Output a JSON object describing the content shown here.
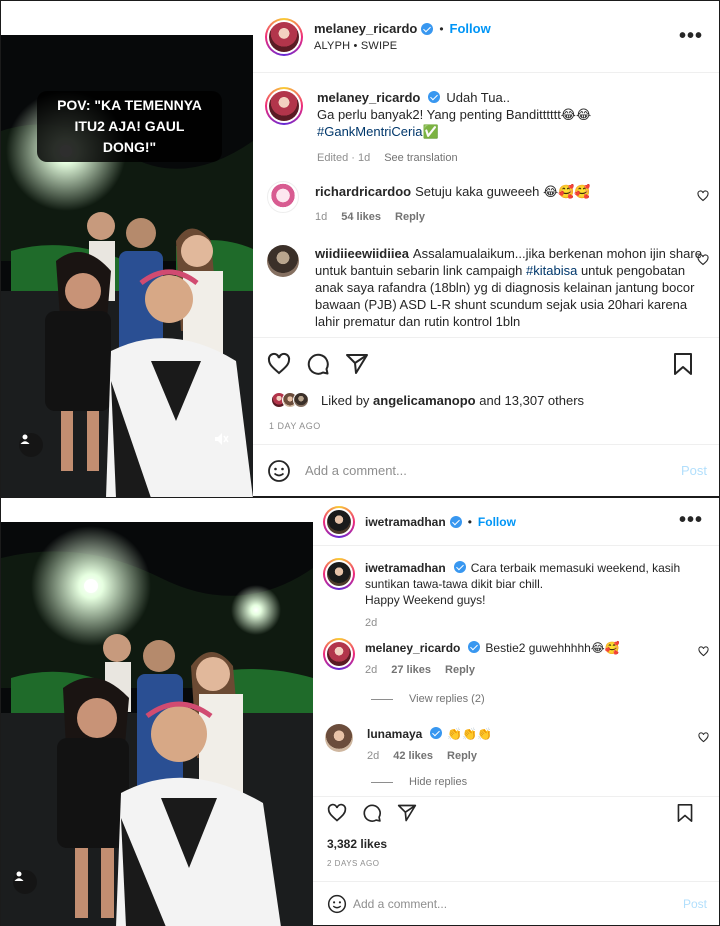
{
  "post1": {
    "overlay_text": "POV: \"KA TEMENNYA ITU2 AJA! GAUL DONG!\"",
    "header": {
      "username": "melaney_ricardo",
      "dot": "•",
      "follow": "Follow",
      "sub": "ALYPH • SWIPE"
    },
    "caption": {
      "username": "melaney_ricardo",
      "line1": "Udah Tua..",
      "line2": "Ga perlu banyak2! Yang penting Banditttttt😂😂",
      "hashtag": "#GankMentriCeria✅",
      "meta_edited": "Edited · 1d",
      "meta_translate": "See translation"
    },
    "comments": [
      {
        "username": "richardricardoo",
        "text": "Setuju kaka guweeeh 😂🥰🥰",
        "time": "1d",
        "likes": "54 likes",
        "reply": "Reply"
      },
      {
        "username": "wiidiieewiidiiea",
        "text": "Assalamualaikum...jika berkenan mohon ijin share untuk bantuin sebarin link campaigh ",
        "hashtag": "#kitabisa",
        "text2": " untuk pengobatan anak saya rafandra (18bln) yg di diagnosis kelainan jantung bocor bawaan (PJB) ASD L-R shunt scundum sejak usia 20hari karena lahir prematur dan rutin kontrol 1bln"
      }
    ],
    "liked_by_prefix": "Liked by",
    "liked_by_user": "angelicamanopo",
    "liked_by_suffix": "and 13,307 others",
    "date": "1 DAY AGO",
    "add_comment": "Add a comment...",
    "post_button": "Post"
  },
  "post2": {
    "header": {
      "username": "iwetramadhan",
      "dot": "•",
      "follow": "Follow"
    },
    "caption": {
      "username": "iwetramadhan",
      "text": "Cara terbaik memasuki weekend, kasih suntikan tawa-tawa dikit biar chill.",
      "line2": "Happy Weekend guys!",
      "time": "2d"
    },
    "comments": [
      {
        "username": "melaney_ricardo",
        "text": "Bestie2 guwehhhhh😂🥰",
        "time": "2d",
        "likes": "27 likes",
        "reply": "Reply",
        "view_replies": "View replies (2)"
      },
      {
        "username": "lunamaya",
        "text": "👏👏👏",
        "time": "2d",
        "likes": "42 likes",
        "reply": "Reply",
        "hide_replies": "Hide replies"
      }
    ],
    "likes": "3,382 likes",
    "date": "2 DAYS AGO",
    "add_comment": "Add a comment...",
    "post_button": "Post"
  },
  "colors": {
    "follow": "#0095f6",
    "verified": "#3897f0",
    "hashtag": "#00376b",
    "muted": "#8e8e8e",
    "post_disabled": "#b2dffc"
  },
  "icons": [
    "heart-icon",
    "comment-icon",
    "share-icon",
    "save-icon",
    "more-icon",
    "emoji-icon",
    "mute-icon",
    "user-tag-icon",
    "verified-icon"
  ]
}
